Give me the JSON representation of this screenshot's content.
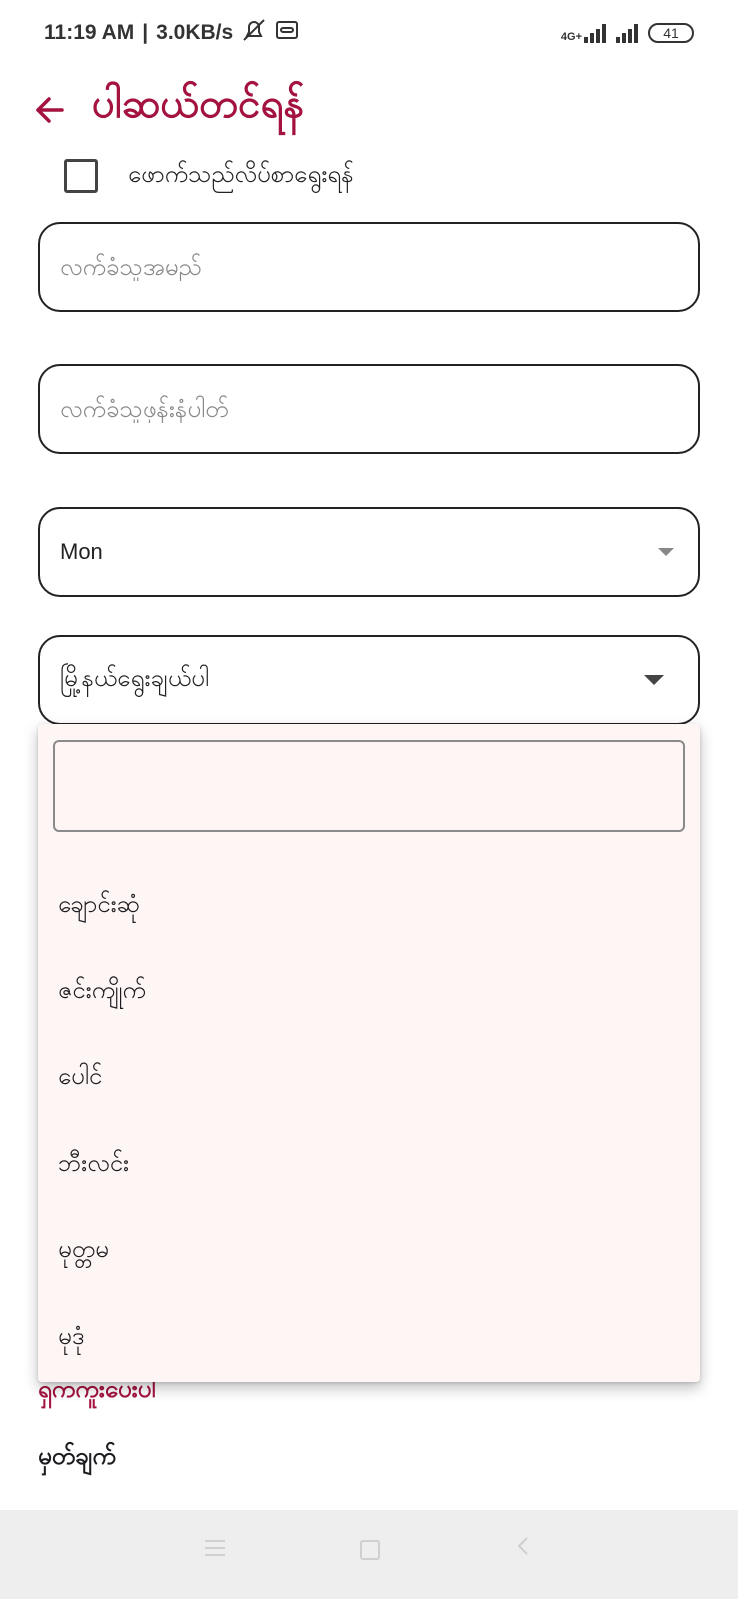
{
  "status_bar": {
    "time": "11:19 AM",
    "speed": "3.0KB/s",
    "network_label": "4G+",
    "battery": "41",
    "icons": [
      "mute-bell-icon",
      "voicemail-icon",
      "signal-icon",
      "signal-icon",
      "battery-icon"
    ]
  },
  "app_bar": {
    "back_icon": "arrow-left-icon",
    "title": "ပါဆယ်တင်ရန်"
  },
  "form": {
    "checkbox_label": "ဖောက်သည်လိပ်စာရွေးရန်",
    "checkbox_checked": false,
    "receiver_name_placeholder": "လက်ခံသူအမည်",
    "receiver_phone_placeholder": "လက်ခံသူဖုန်းနံပါတ်",
    "state_select_value": "Mon",
    "township_select_placeholder": "မြို့နယ်ရွေးချယ်ပါ",
    "partially_hidden_label": "ရှကကူးပေးပါ",
    "note_label": "မှတ်ချက်"
  },
  "dropdown": {
    "search_value": "",
    "options": [
      "ချောင်းဆုံ",
      "ဇင်းကျိုက်",
      "ပေါင်",
      "ဘီးလင်း",
      "မုတ္တမ",
      "မုဒုံ"
    ]
  },
  "colors": {
    "accent": "#a4123f",
    "dropdown_bg": "#fdf6f4",
    "nav_bg": "#eeeeee"
  }
}
